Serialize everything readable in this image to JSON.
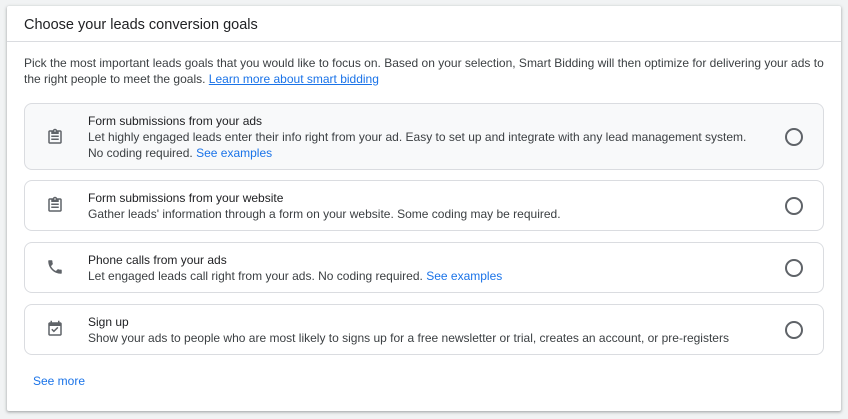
{
  "header": {
    "title": "Choose your leads conversion goals"
  },
  "intro": {
    "text": "Pick the most important leads goals that you would like to focus on. Based on your selection, Smart Bidding will then optimize for delivering your ads to the right people to meet the goals. ",
    "link_label": "Learn more about smart bidding"
  },
  "options": [
    {
      "icon": "clipboard-form-icon",
      "title": "Form submissions from your ads",
      "description": "Let highly engaged leads enter their info right from your ad. Easy to set up and integrate with any lead management system. No coding required. ",
      "link_label": "See examples",
      "selected": false
    },
    {
      "icon": "clipboard-form-icon",
      "title": "Form submissions from your website",
      "description": "Gather leads' information through a form on your website. Some coding may be required.",
      "selected": false
    },
    {
      "icon": "phone-icon",
      "title": "Phone calls from your ads",
      "description": "Let engaged leads call right from your ads. No coding required. ",
      "link_label": "See examples",
      "selected": false
    },
    {
      "icon": "checkbox-calendar-icon",
      "title": "Sign up",
      "description": "Show your ads to people who are most likely to signs up for a free newsletter or trial, creates an account, or pre-registers",
      "selected": false
    }
  ],
  "footer": {
    "see_more_label": "See more"
  },
  "colors": {
    "link": "#1a73e8",
    "border": "#dadce0",
    "selected_bg": "#f8f9fa",
    "icon": "#5f6368"
  }
}
